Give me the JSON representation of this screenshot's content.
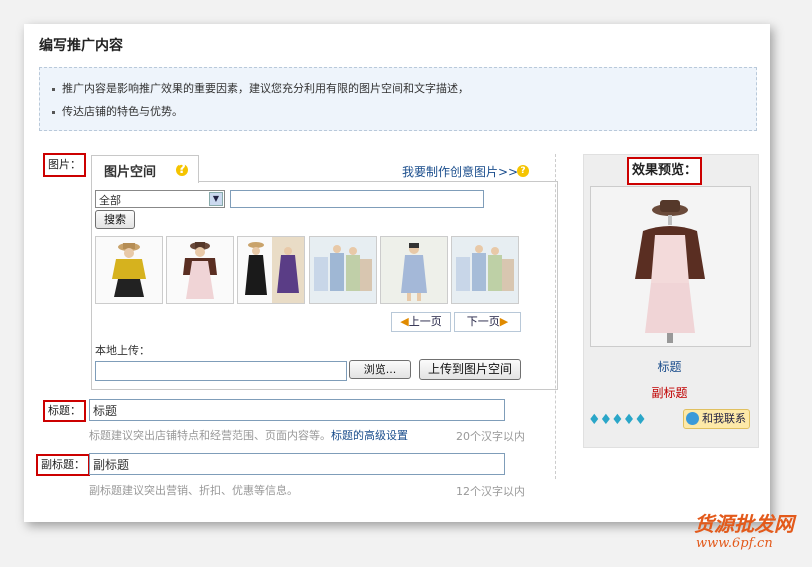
{
  "header": {
    "title": "编写推广内容"
  },
  "notice": {
    "line1": "推广内容是影响推广效果的重要因素，建议您充分利用有限的图片空间和文字描述，",
    "line2": "传达店铺的特色与优势。"
  },
  "image_section": {
    "label": "图片：",
    "tab_label": "图片空间",
    "create_link": "我要制作创意图片>>",
    "category_select": {
      "value": "全部"
    },
    "search_input": {
      "value": "",
      "placeholder": ""
    },
    "search_button": "搜索",
    "thumbnails": [
      {
        "name": "yellow-top-outfit"
      },
      {
        "name": "brown-cardigan-dress"
      },
      {
        "name": "black-and-purple-dresses"
      },
      {
        "name": "floral-dress-group"
      },
      {
        "name": "floral-dress-model"
      },
      {
        "name": "floral-dress-group-2"
      }
    ],
    "prev_page": "上一页",
    "next_page": "下一页",
    "local_upload_label": "本地上传：",
    "browse_button": "浏览...",
    "upload_button": "上传到图片空间"
  },
  "title_section": {
    "label": "标题：",
    "value": "标题",
    "hint": "标题建议突出店铺特点和经营范围、页面内容等。",
    "advanced_link": "标题的高级设置",
    "limit": "20个汉字以内"
  },
  "subtitle_section": {
    "label": "副标题：",
    "value": "副标题",
    "hint": "副标题建议突出营销、折扣、优惠等信息。",
    "limit": "12个汉字以内"
  },
  "preview": {
    "heading": "效果预览：",
    "title": "标题",
    "subtitle": "副标题",
    "contact_button": "和我联系",
    "diamond_count": 5
  },
  "watermark": {
    "line1": "货源批发网",
    "line2": "www.6pf.cn"
  },
  "colors": {
    "accent_link": "#1a4d8c",
    "subtitle_red": "#c00000",
    "alert_border": "#c00000",
    "notice_bg": "#eef4fb"
  }
}
